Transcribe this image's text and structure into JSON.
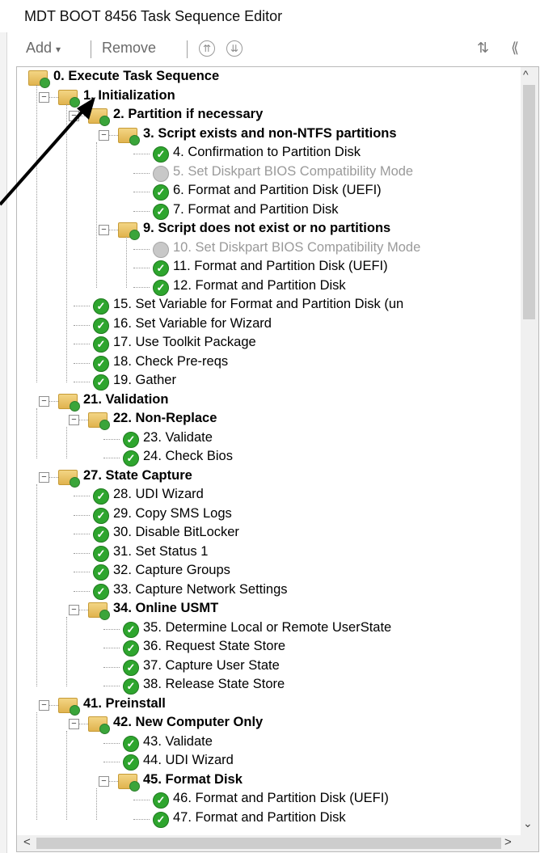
{
  "window": {
    "title": "MDT BOOT 8456 Task Sequence Editor"
  },
  "toolbar": {
    "add_label": "Add",
    "add_caret": "▾",
    "remove_label": "Remove",
    "up_symbol": "⇈",
    "down_symbol": "⇊",
    "right_icons": [
      "⇅",
      "⟪"
    ]
  },
  "scroll": {
    "up": "^",
    "down": "⌄",
    "left": "<",
    "right": ">"
  },
  "tree_items": [
    {
      "label": "0. Execute Task Sequence",
      "type": "folder"
    },
    {
      "label": "1. Initialization",
      "type": "folder"
    },
    {
      "label": "2. Partition if necessary",
      "type": "folder"
    },
    {
      "label": "3. Script exists and non-NTFS partitions",
      "type": "folder"
    },
    {
      "label": "4. Confirmation to Partition Disk",
      "type": "step"
    },
    {
      "label": "5. Set Diskpart BIOS Compatibility Mode",
      "type": "step-disabled"
    },
    {
      "label": "6. Format and Partition Disk (UEFI)",
      "type": "step"
    },
    {
      "label": "7. Format and Partition Disk",
      "type": "step"
    },
    {
      "label": "9. Script does not exist or no partitions",
      "type": "folder"
    },
    {
      "label": "10. Set Diskpart BIOS Compatibility Mode",
      "type": "step-disabled"
    },
    {
      "label": "11. Format and Partition Disk (UEFI)",
      "type": "step"
    },
    {
      "label": "12. Format and Partition Disk",
      "type": "step"
    },
    {
      "label": "15. Set Variable for Format and Partition Disk (un",
      "type": "step"
    },
    {
      "label": "16. Set Variable for Wizard",
      "type": "step"
    },
    {
      "label": "17. Use Toolkit Package",
      "type": "step"
    },
    {
      "label": "18. Check Pre-reqs",
      "type": "step"
    },
    {
      "label": "19. Gather",
      "type": "step"
    },
    {
      "label": "21. Validation",
      "type": "folder"
    },
    {
      "label": "22. Non-Replace",
      "type": "folder"
    },
    {
      "label": "23. Validate",
      "type": "step"
    },
    {
      "label": "24. Check Bios",
      "type": "step"
    },
    {
      "label": "27. State Capture",
      "type": "folder"
    },
    {
      "label": "28. UDI Wizard",
      "type": "step"
    },
    {
      "label": "29. Copy SMS Logs",
      "type": "step"
    },
    {
      "label": "30. Disable BitLocker",
      "type": "step"
    },
    {
      "label": "31. Set Status 1",
      "type": "step"
    },
    {
      "label": "32. Capture Groups",
      "type": "step"
    },
    {
      "label": "33. Capture Network Settings",
      "type": "step"
    },
    {
      "label": "34. Online USMT",
      "type": "folder"
    },
    {
      "label": "35. Determine Local or Remote UserState",
      "type": "step"
    },
    {
      "label": "36. Request State Store",
      "type": "step"
    },
    {
      "label": "37. Capture User State",
      "type": "step"
    },
    {
      "label": "38. Release State Store",
      "type": "step"
    },
    {
      "label": "41. Preinstall",
      "type": "folder"
    },
    {
      "label": "42. New Computer Only",
      "type": "folder"
    },
    {
      "label": "43. Validate",
      "type": "step"
    },
    {
      "label": "44. UDI Wizard",
      "type": "step"
    },
    {
      "label": "45. Format Disk",
      "type": "folder"
    },
    {
      "label": "46. Format and Partition Disk (UEFI)",
      "type": "step"
    },
    {
      "label": "47. Format and Partition Disk",
      "type": "step"
    }
  ]
}
